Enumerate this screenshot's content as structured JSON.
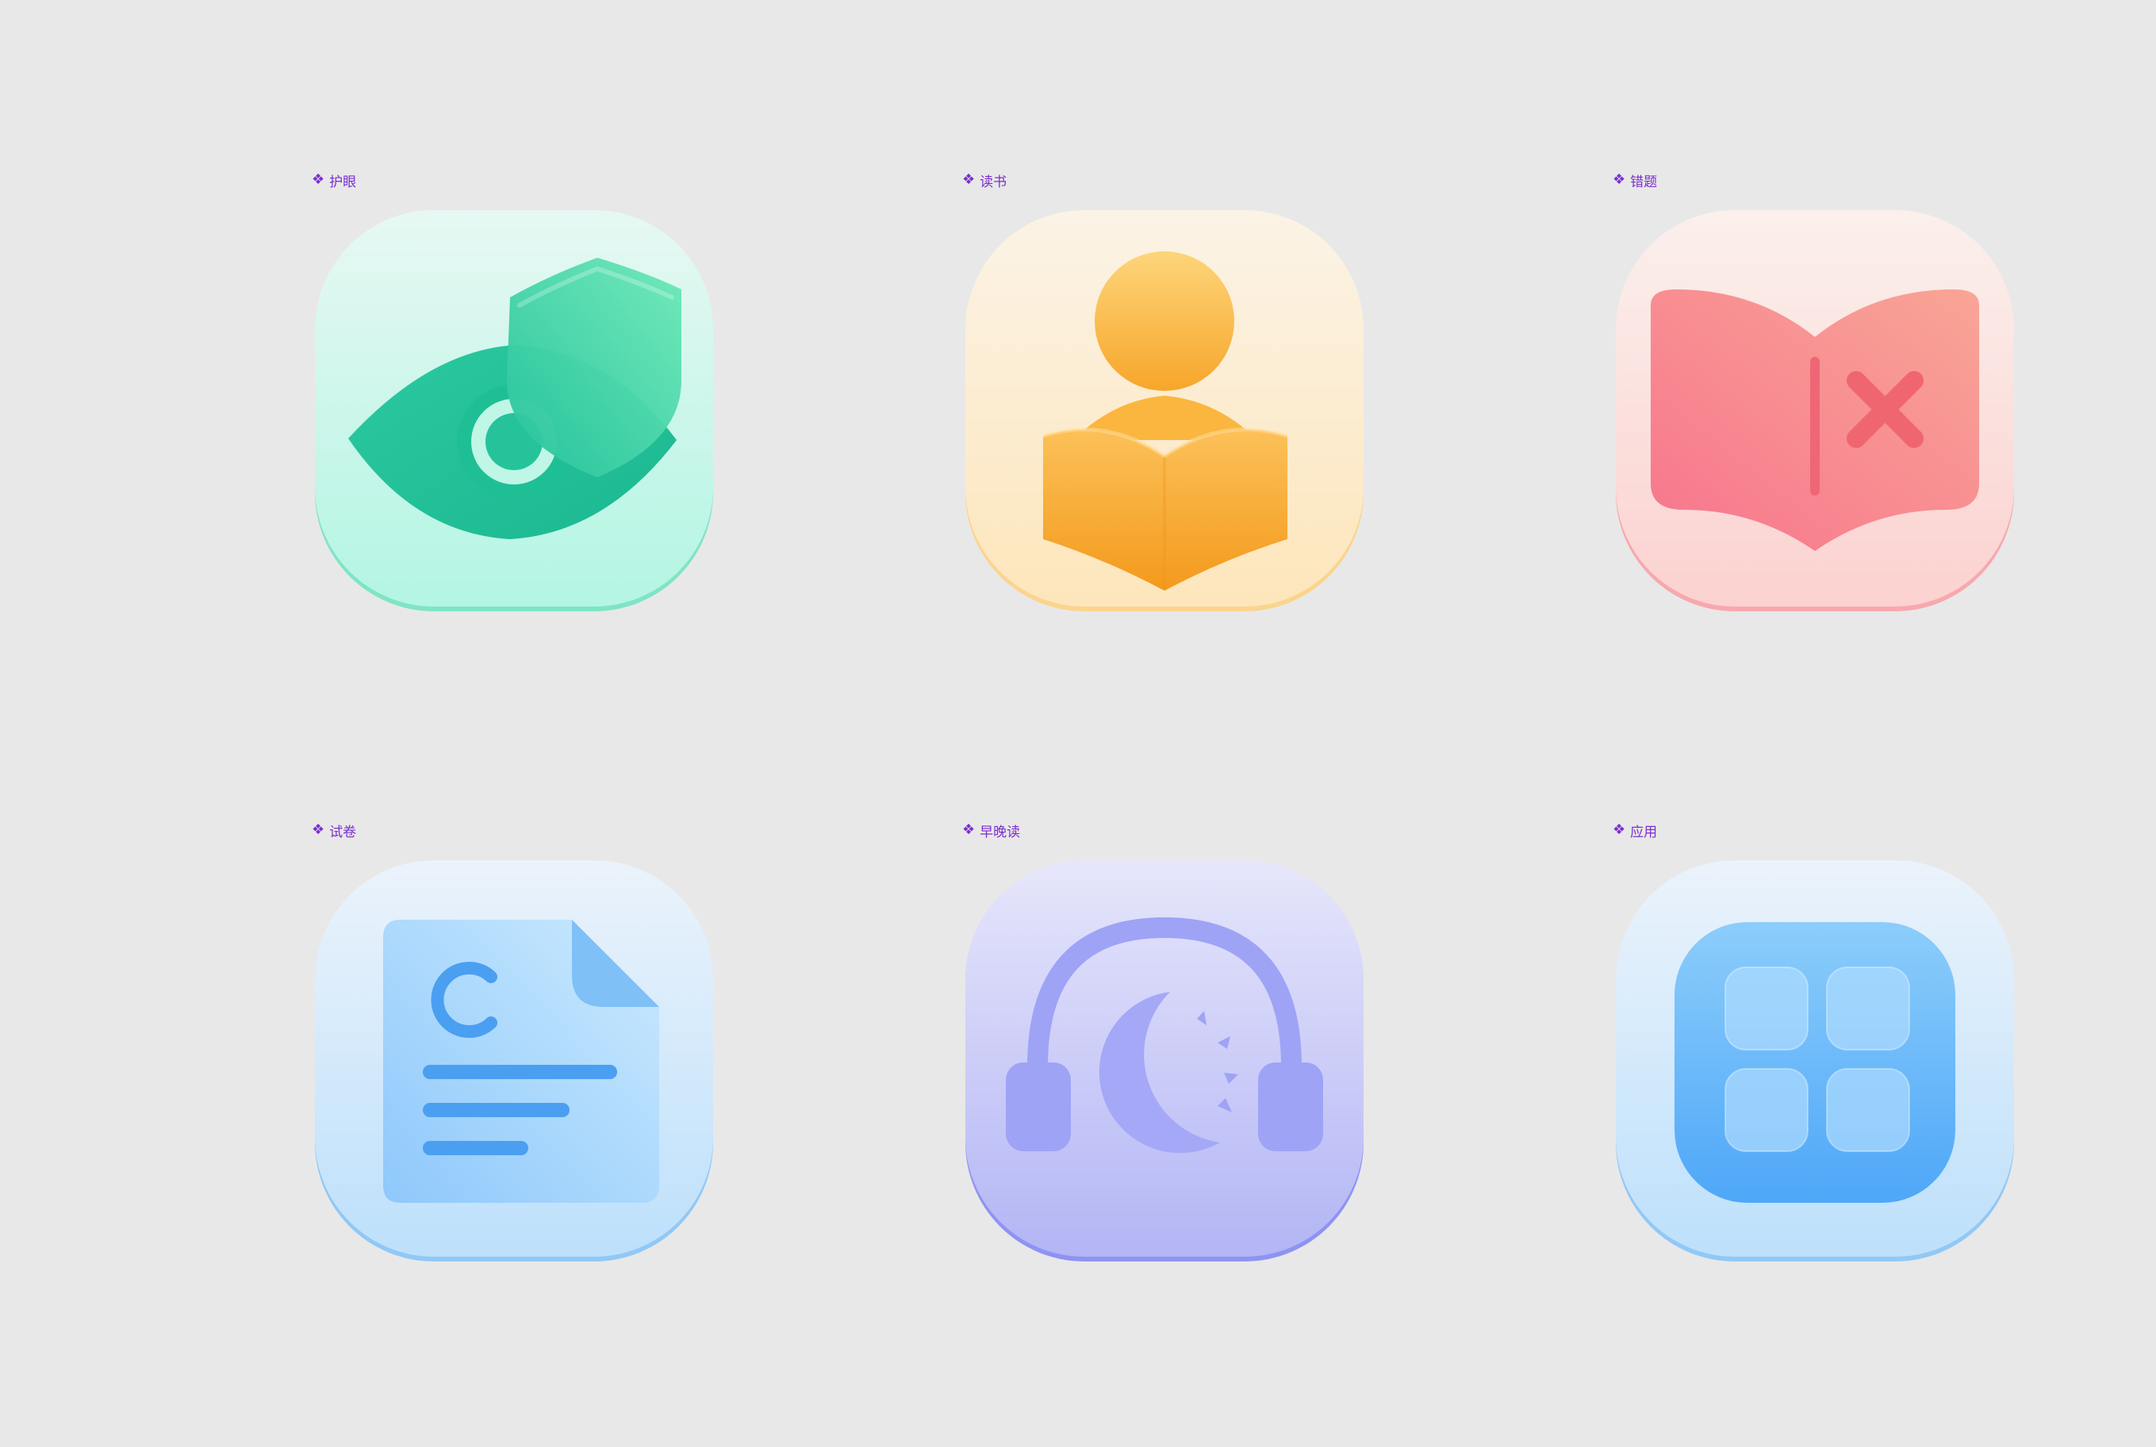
{
  "canvas": {
    "background": "#e8e8e8",
    "label_color": "#7b2fd0"
  },
  "components": [
    {
      "id": "eye-care",
      "glyph": "❖",
      "label": "护眼",
      "icon": "eye-shield-icon",
      "accent": "#22c59b"
    },
    {
      "id": "reading",
      "glyph": "❖",
      "label": "读书",
      "icon": "person-reading-icon",
      "accent": "#f7a524"
    },
    {
      "id": "mistakes",
      "glyph": "❖",
      "label": "错题",
      "icon": "book-cross-icon",
      "accent": "#f36b7d"
    },
    {
      "id": "exam-paper",
      "glyph": "❖",
      "label": "试卷",
      "icon": "exam-paper-icon",
      "accent": "#4a9ff1"
    },
    {
      "id": "morning-evening-reading",
      "glyph": "❖",
      "label": "早晚读",
      "icon": "headphones-moon-icon",
      "accent": "#8e93f3"
    },
    {
      "id": "apps",
      "glyph": "❖",
      "label": "应用",
      "icon": "app-grid-icon",
      "accent": "#4ea7f8"
    }
  ]
}
